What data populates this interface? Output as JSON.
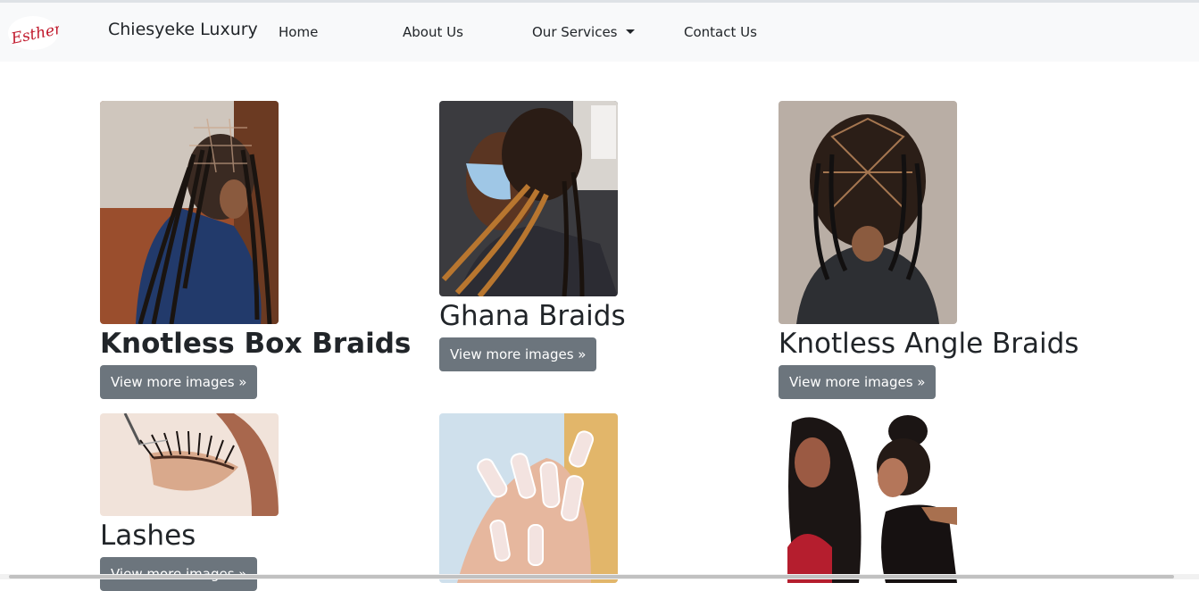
{
  "navbar": {
    "logo_text": "Esther",
    "brand": "Chiesyeke Luxury",
    "links": [
      {
        "label": "Home"
      },
      {
        "label": "About Us"
      },
      {
        "label": "Our Services"
      },
      {
        "label": "Contact Us"
      }
    ]
  },
  "services": [
    {
      "title": "Knotless Box Braids",
      "button": "View more images »"
    },
    {
      "title": "Ghana Braids",
      "button": "View more images »"
    },
    {
      "title": "Knotless Angle Braids",
      "button": "View more images »"
    },
    {
      "title": "Lashes",
      "button": "View more images »"
    },
    {
      "title": "",
      "button": ""
    },
    {
      "title": "",
      "button": ""
    }
  ],
  "colors": {
    "navbar_bg": "#f8f9fa",
    "button_bg": "#6c757d",
    "logo_red": "#c0182b"
  }
}
